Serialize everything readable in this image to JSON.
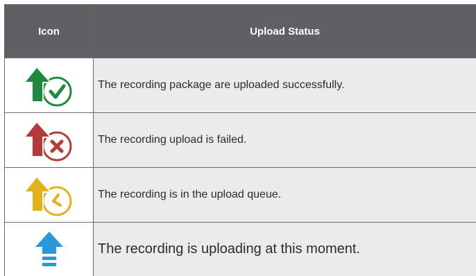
{
  "table": {
    "headers": {
      "icon": "Icon",
      "status": "Upload Status"
    },
    "rows": [
      {
        "icon": "upload-success-icon",
        "color": "#1e8a3c",
        "text": "The recording package are uploaded successfully."
      },
      {
        "icon": "upload-failed-icon",
        "color": "#b63a3a",
        "text": "The recording upload is failed."
      },
      {
        "icon": "upload-queued-icon",
        "color": "#e2b21c",
        "text": "The recording is in the upload queue."
      },
      {
        "icon": "uploading-icon",
        "color": "#2a98d8",
        "text": "The recording is uploading at this moment."
      }
    ]
  }
}
